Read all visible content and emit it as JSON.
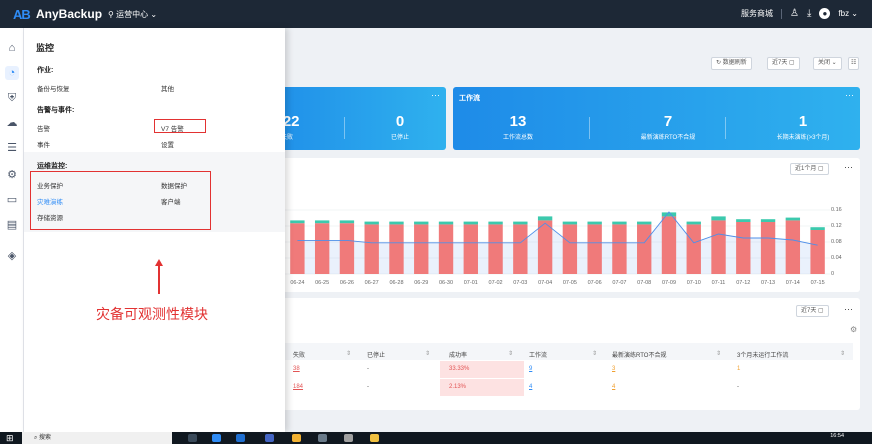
{
  "header": {
    "logo_mark": "AB",
    "app_name": "AnyBackup",
    "location": "运营中心 ⌄",
    "service_store": "服务商城",
    "user": "fbz ⌄"
  },
  "dashboard": {
    "toolbar": {
      "refresh": "数据刷新",
      "days7": "近7天",
      "close": "关闭 ⌄"
    },
    "card1": {
      "num_a": "222",
      "lbl_a": "失败",
      "num_b": "0",
      "lbl_b": "已停止"
    },
    "card2": {
      "title": "工作流",
      "stats": [
        {
          "num": "13",
          "lbl": "工作流总数"
        },
        {
          "num": "7",
          "lbl": "最新演练RTO不合规"
        },
        {
          "num": "1",
          "lbl": "长期未演练(>3个月)"
        }
      ]
    },
    "chart_range": "近1个月",
    "table_range": "近7天"
  },
  "chart_data": {
    "type": "bar",
    "categories": [
      "06-24",
      "06-25",
      "06-26",
      "06-27",
      "06-28",
      "06-29",
      "06-30",
      "07-01",
      "07-02",
      "07-03",
      "07-04",
      "07-05",
      "07-06",
      "07-07",
      "07-08",
      "07-09",
      "07-10",
      "07-11",
      "07-12",
      "07-13",
      "07-14",
      "07-15"
    ],
    "series": [
      {
        "values": [
          0.127,
          0.127,
          0.127,
          0.124,
          0.124,
          0.124,
          0.124,
          0.124,
          0.124,
          0.124,
          0.134,
          0.124,
          0.124,
          0.124,
          0.124,
          0.144,
          0.124,
          0.134,
          0.13,
          0.13,
          0.134,
          0.11
        ]
      },
      {
        "values": [
          0.007,
          0.007,
          0.007,
          0.007,
          0.007,
          0.007,
          0.007,
          0.007,
          0.007,
          0.007,
          0.01,
          0.007,
          0.007,
          0.007,
          0.007,
          0.01,
          0.007,
          0.01,
          0.007,
          0.007,
          0.007,
          0.007
        ]
      },
      {
        "values": [
          0.084,
          0.084,
          0.084,
          0.078,
          0.078,
          0.078,
          0.078,
          0.078,
          0.078,
          0.078,
          0.127,
          0.078,
          0.078,
          0.078,
          0.078,
          0.155,
          0.078,
          0.1,
          0.09,
          0.09,
          0.085,
          0.072
        ]
      }
    ],
    "ylim": [
      0,
      0.16
    ],
    "yticks": [
      "0.16",
      "0.12",
      "0.08",
      "0.04",
      "0"
    ]
  },
  "table": {
    "headers": [
      "失败",
      "已停止",
      "成功率",
      "工作流",
      "最新演练RTO不合规",
      "3个月未运行工作流"
    ],
    "rows": [
      [
        "38",
        "-",
        "33.33%",
        "9",
        "3",
        "1"
      ],
      [
        "184",
        "-",
        "2.13%",
        "4",
        "4",
        "-"
      ]
    ]
  },
  "menu": {
    "title": "监控",
    "job": {
      "title": "作业:",
      "items": [
        "备份与恢复",
        "其他"
      ]
    },
    "alarm": {
      "title": "告警与事件:",
      "items": [
        "告警",
        "V7 告警",
        "事件",
        "设置"
      ]
    },
    "ops": {
      "title": "运维监控:",
      "items": [
        "业务保护",
        "数据保护",
        "灾难演练",
        "客户端",
        "存储资源"
      ]
    }
  },
  "annotation": "灾备可观测性模块",
  "taskbar": {
    "search": "搜索",
    "time": "16:54"
  },
  "colors": {
    "accent": "#2f8cf6",
    "bar": "#f07a7a",
    "bar_cap": "#3cc9ad",
    "line": "#4f8fe8",
    "annotation": "#e23232"
  }
}
